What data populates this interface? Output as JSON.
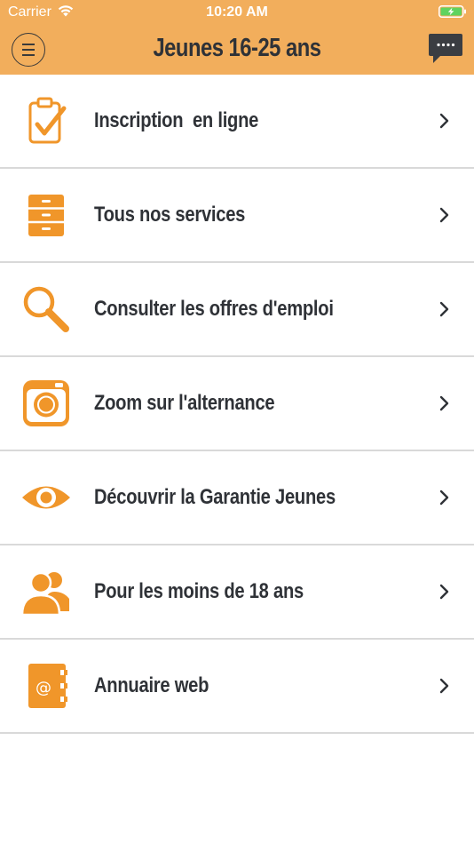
{
  "status_bar": {
    "carrier": "Carrier",
    "time": "10:20 AM"
  },
  "header": {
    "title": "Jeunes 16-25 ans",
    "menu_icon": "hamburger-menu-icon",
    "chat_icon": "chat-bubble-icon"
  },
  "colors": {
    "accent": "#f2ae5c",
    "icon_orange": "#f0962a",
    "text_dark": "#2f3237",
    "divider": "#d9d9d9"
  },
  "menu": {
    "items": [
      {
        "label": "Inscription  en ligne",
        "icon": "clipboard-check-icon"
      },
      {
        "label": "Tous nos services",
        "icon": "filing-cabinet-icon"
      },
      {
        "label": "Consulter les offres d'emploi",
        "icon": "magnifier-icon"
      },
      {
        "label": "Zoom sur l'alternance",
        "icon": "camera-icon"
      },
      {
        "label": "Découvrir la Garantie Jeunes",
        "icon": "eye-icon"
      },
      {
        "label": "Pour les moins de 18 ans",
        "icon": "users-icon"
      },
      {
        "label": "Annuaire web",
        "icon": "address-book-icon"
      }
    ]
  }
}
